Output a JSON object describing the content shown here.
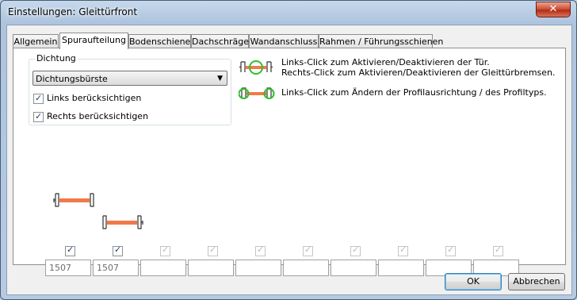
{
  "window": {
    "title": "Einstellungen: Gleittürfront",
    "close_glyph": "✕"
  },
  "tabs": [
    {
      "label": "Allgemein",
      "active": false
    },
    {
      "label": "Spuraufteilung",
      "active": true
    },
    {
      "label": "Bodenschiene",
      "active": false
    },
    {
      "label": "Dachschräge",
      "active": false
    },
    {
      "label": "Wandanschluss",
      "active": false
    },
    {
      "label": "Rahmen / Führungsschienen",
      "active": false
    }
  ],
  "seal": {
    "group_label": "Dichtung",
    "select_value": "Dichtungsbürste",
    "left_label": "Links berücksichtigen",
    "left_checked": true,
    "right_label": "Rechts berücksichtigen",
    "right_checked": true
  },
  "help": {
    "line1": "Links-Click zum Aktivieren/Deaktivieren der Tür.",
    "line2": "Rechts-Click zum Aktivieren/Deaktivieren der Gleittürbremsen.",
    "line3": "Links-Click zum Ändern der Profilausrichtung / des Profiltyps."
  },
  "tracks": {
    "columns": [
      {
        "checked": true,
        "enabled": true,
        "value": "1507"
      },
      {
        "checked": true,
        "enabled": true,
        "value": "1507"
      },
      {
        "checked": true,
        "enabled": false,
        "value": ""
      },
      {
        "checked": true,
        "enabled": false,
        "value": ""
      },
      {
        "checked": true,
        "enabled": false,
        "value": ""
      },
      {
        "checked": true,
        "enabled": false,
        "value": ""
      },
      {
        "checked": true,
        "enabled": false,
        "value": ""
      },
      {
        "checked": true,
        "enabled": false,
        "value": ""
      },
      {
        "checked": true,
        "enabled": false,
        "value": ""
      },
      {
        "checked": true,
        "enabled": false,
        "value": ""
      }
    ]
  },
  "buttons": {
    "ok": "OK",
    "cancel": "Abbrechen"
  },
  "colors": {
    "door": "#f07a4a",
    "highlight": "#2ec02e",
    "accent": "#1a3f78"
  }
}
